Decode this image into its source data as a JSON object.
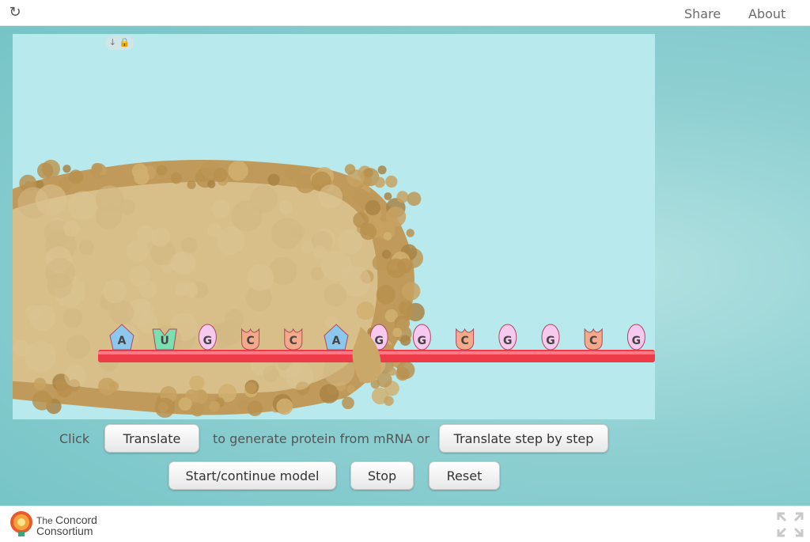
{
  "header": {
    "reload_icon": "reload-icon",
    "share_label": "Share",
    "about_label": "About"
  },
  "model": {
    "lock_icons": "↓ 🔒",
    "mrna_color": "#ee3b4a",
    "ribosome_color": "#d8bf8a",
    "background_color": "#b7e9ed",
    "bases": [
      {
        "letter": "A",
        "shape": "pentagon",
        "color": "#8cc8ee"
      },
      {
        "letter": "U",
        "shape": "chevron",
        "color": "#7be0b0"
      },
      {
        "letter": "G",
        "shape": "oval",
        "color": "#f7c9ee"
      },
      {
        "letter": "C",
        "shape": "cup",
        "color": "#f4a98a"
      },
      {
        "letter": "C",
        "shape": "cup",
        "color": "#f4a98a"
      },
      {
        "letter": "A",
        "shape": "pentagon",
        "color": "#8cc8ee"
      },
      {
        "letter": "G",
        "shape": "oval",
        "color": "#f7c9ee"
      },
      {
        "letter": "G",
        "shape": "oval",
        "color": "#f7c9ee"
      },
      {
        "letter": "C",
        "shape": "cup",
        "color": "#f4a98a"
      },
      {
        "letter": "G",
        "shape": "oval",
        "color": "#f7c9ee"
      },
      {
        "letter": "G",
        "shape": "oval",
        "color": "#f7c9ee"
      },
      {
        "letter": "C",
        "shape": "cup",
        "color": "#f4a98a"
      },
      {
        "letter": "G",
        "shape": "oval",
        "color": "#f7c9ee"
      }
    ]
  },
  "controls": {
    "click_text": "Click",
    "translate_label": "Translate",
    "middle_text": "to generate protein from mRNA or",
    "step_label": "Translate step by step",
    "start_label": "Start/continue model",
    "stop_label": "Stop",
    "reset_label": "Reset"
  },
  "footer": {
    "logo_the": "The",
    "logo_concord": "Concord",
    "logo_consortium": "Consortium",
    "fullscreen_icon": "fullscreen-icon"
  }
}
